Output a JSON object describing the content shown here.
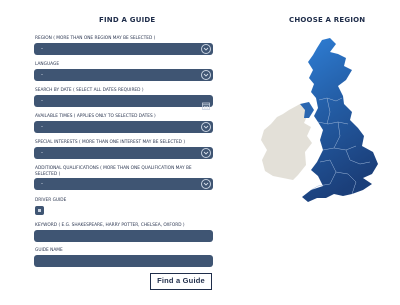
{
  "left_heading": "FIND A GUIDE",
  "right_heading": "CHOOSE A REGION",
  "fields": {
    "region": {
      "label": "REGION  ( MORE THAN ONE REGION MAY BE SELECTED )",
      "value": "-"
    },
    "language": {
      "label": "LANGUAGE",
      "value": "-"
    },
    "date": {
      "label": "SEARCH BY DATE  ( SELECT ALL DATES REQUIRED )",
      "value": "-"
    },
    "times": {
      "label": "AVAILABLE TIMES  ( APPLIES ONLY TO SELECTED DATES )",
      "value": "-"
    },
    "interests": {
      "label": "SPECIAL INTERESTS  ( MORE THAN ONE INTEREST MAY BE SELECTED )",
      "value": "-"
    },
    "qualifications": {
      "label": "ADDITIONAL QUALIFICATIONS  ( MORE THAN ONE QUALIFICATION MAY BE SELECTED )",
      "value": "-"
    },
    "driver_guide": {
      "label": "DRIVER GUIDE"
    },
    "keyword": {
      "label": "KEYWORD  ( E.G. SHAKESPEARE, HARRY POTTER, CHELSEA, OXFORD )",
      "value": ""
    },
    "guide_name": {
      "label": "GUIDE NAME",
      "value": ""
    }
  },
  "button": {
    "label": "Find a Guide"
  },
  "colors": {
    "field_bg": "#3f5573",
    "text_dark": "#1f2d4a",
    "ireland": "#e3e0d8",
    "uk_light": "#2f7fd6",
    "uk_dark": "#1b3f7a"
  }
}
